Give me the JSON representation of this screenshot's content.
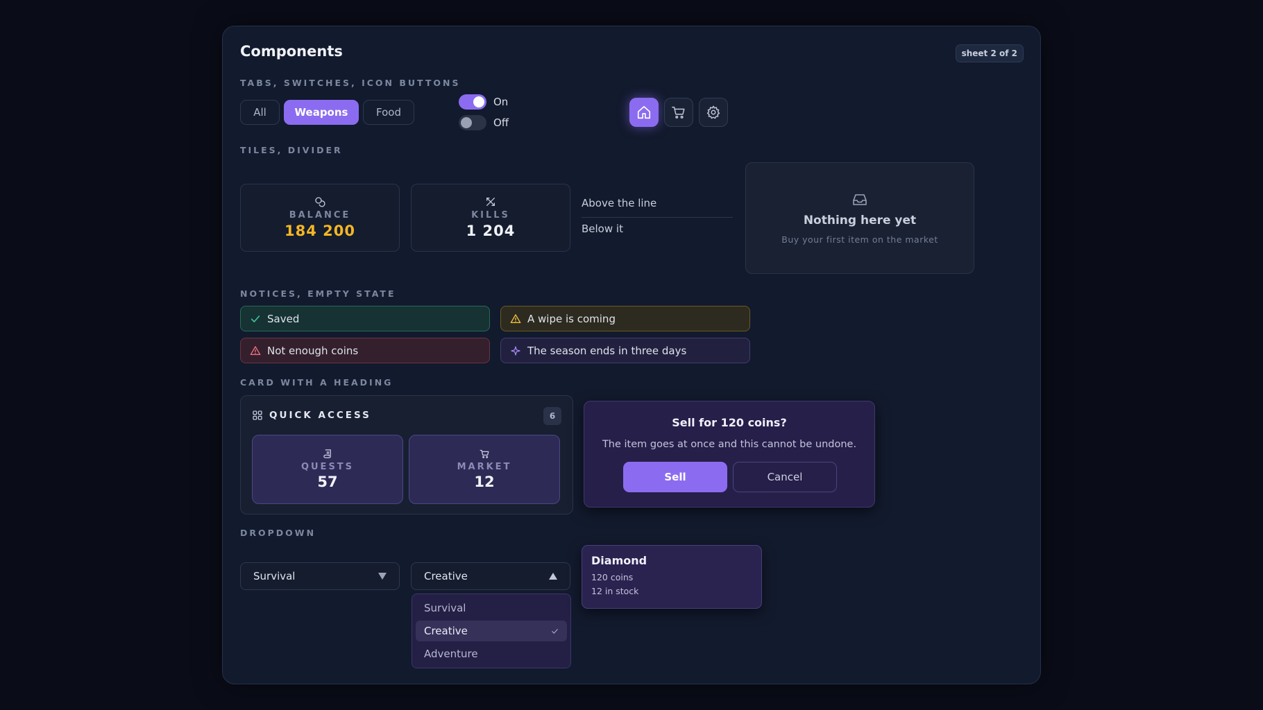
{
  "header": {
    "title": "Components",
    "sheet": "sheet 2 of 2"
  },
  "sections": {
    "tabs": "TABS, SWITCHES, ICON BUTTONS",
    "tiles": "TILES, DIVIDER",
    "notices": "NOTICES, EMPTY STATE",
    "card": "CARD WITH A HEADING",
    "dropdown": "DROPDOWN"
  },
  "tabs": [
    {
      "label": "All",
      "active": false
    },
    {
      "label": "Weapons",
      "active": true
    },
    {
      "label": "Food",
      "active": false
    }
  ],
  "switches": [
    {
      "label": "On",
      "state": true
    },
    {
      "label": "Off",
      "state": false
    }
  ],
  "icon_buttons": [
    {
      "icon": "home-icon",
      "active": true
    },
    {
      "icon": "cart-icon",
      "active": false
    },
    {
      "icon": "gear-icon",
      "active": false
    }
  ],
  "tiles": [
    {
      "icon": "coins-icon",
      "label": "BALANCE",
      "value": "184 200",
      "color": "#f5b625"
    },
    {
      "icon": "crossed-swords-icon",
      "label": "KILLS",
      "value": "1 204",
      "color": "#f0f2f8"
    }
  ],
  "divider": {
    "above": "Above the line",
    "below": "Below it"
  },
  "empty_state": {
    "icon": "inbox-icon",
    "title": "Nothing here yet",
    "subtitle": "Buy your first item on the market"
  },
  "notices": [
    {
      "type": "success",
      "icon": "check-icon",
      "text": "Saved"
    },
    {
      "type": "warning",
      "icon": "warning-icon",
      "text": "A wipe is coming"
    },
    {
      "type": "error",
      "icon": "alert-icon",
      "text": "Not enough coins"
    },
    {
      "type": "info",
      "icon": "sparkle-icon",
      "text": "The season ends in three days"
    }
  ],
  "card": {
    "icon": "grid-icon",
    "title": "QUICK ACCESS",
    "badge": "6",
    "items": [
      {
        "icon": "scroll-icon",
        "label": "QUESTS",
        "value": "57"
      },
      {
        "icon": "cart-icon",
        "label": "MARKET",
        "value": "12"
      }
    ]
  },
  "dialog": {
    "title": "Sell for 120 coins?",
    "body": "The item goes at once and this cannot be undone.",
    "confirm": "Sell",
    "cancel": "Cancel"
  },
  "dropdowns": [
    {
      "value": "Survival",
      "open": false
    },
    {
      "value": "Creative",
      "open": true,
      "options": [
        "Survival",
        "Creative",
        "Adventure"
      ],
      "selected": "Creative"
    }
  ],
  "tooltip": {
    "title": "Diamond",
    "line1": "120 coins",
    "line2": "12 in stock"
  },
  "colors": {
    "accent": "#8b6cf0",
    "gold": "#f5b625",
    "success": "#3fc99a",
    "warning": "#f0c040",
    "error": "#f07080",
    "info": "#a78bfa"
  }
}
